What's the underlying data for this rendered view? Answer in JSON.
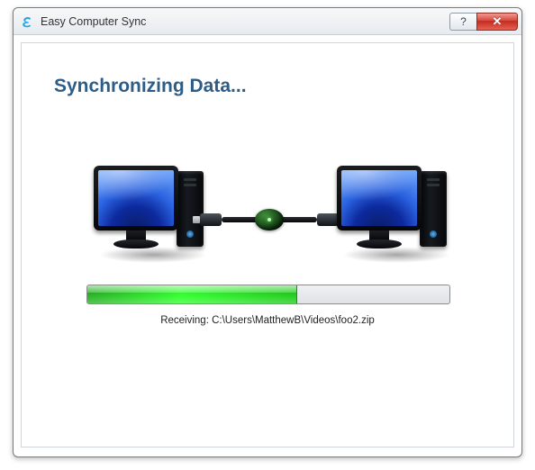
{
  "window": {
    "title": "Easy Computer Sync",
    "icon": "sync-s-icon"
  },
  "titlebar": {
    "help_label": "?",
    "close_label": "✕"
  },
  "content": {
    "heading": "Synchronizing Data..."
  },
  "progress": {
    "percent": 58
  },
  "status": {
    "prefix": "Receiving: ",
    "path": "C:\\Users\\MatthewB\\Videos\\foo2.zip"
  },
  "colors": {
    "heading": "#2d5d87",
    "progress_green": "#2bff28",
    "close_red": "#d6463a"
  }
}
